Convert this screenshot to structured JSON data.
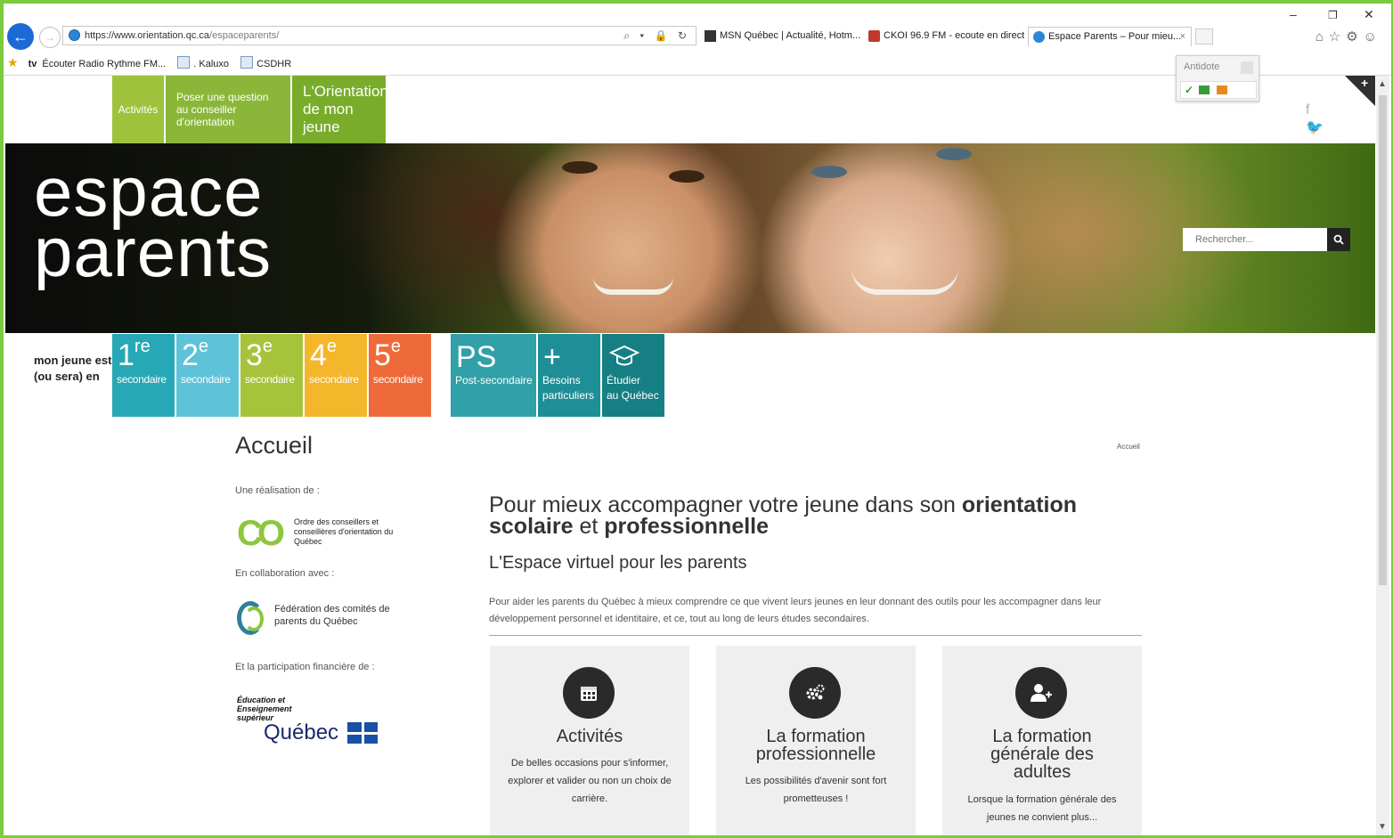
{
  "browser": {
    "url_host": "https://www.orientation.qc.ca",
    "url_path": "/espaceparents/",
    "addr_tools": "⌕ ▾ 🔒 ↻",
    "tabs": [
      {
        "label": "MSN Québec | Actualité, Hotm..."
      },
      {
        "label": "CKOI 96.9 FM - ecoute en direct"
      },
      {
        "label": "Espace Parents – Pour mieu..."
      }
    ],
    "tab_close": "×",
    "favorites": [
      {
        "label": "Écouter Radio Rythme FM..."
      },
      {
        "label": ". Kaluxo"
      },
      {
        "label": "CSDHR"
      }
    ],
    "fav_tv": "tv",
    "win_min": "–",
    "win_restore": "❐",
    "win_close": "✕",
    "right_icons": "⌂☆⚙☺",
    "antidote_label": "Antidote"
  },
  "page": {
    "nav": [
      {
        "label": "Activités"
      },
      {
        "label": "Poser une question au conseiller d'orientation"
      },
      {
        "label": "L'Orientation de mon jeune"
      }
    ],
    "social": "f 🐦",
    "hero_title_1": "espace",
    "hero_title_2": "parents",
    "search_placeholder": "Rechercher...",
    "mon_jeune_1": "mon jeune est",
    "mon_jeune_2": "(ou sera) en",
    "levels": [
      {
        "num": "1",
        "sup": "re",
        "word": "secondaire"
      },
      {
        "num": "2",
        "sup": "e",
        "word": "secondaire"
      },
      {
        "num": "3",
        "sup": "e",
        "word": "secondaire"
      },
      {
        "num": "4",
        "sup": "e",
        "word": "secondaire"
      },
      {
        "num": "5",
        "sup": "e",
        "word": "secondaire"
      }
    ],
    "ps": {
      "big": "PS",
      "small": "Post-secondaire"
    },
    "besoins": {
      "big": "+",
      "small1": "Besoins",
      "small2": "particuliers"
    },
    "etudier": {
      "small1": "Étudier",
      "small2": "au Québec"
    },
    "title": "Accueil",
    "breadcrumb": "Accueil",
    "realisation": "Une réalisation de :",
    "occoq": "Ordre des conseillers et conseillères d'orientation du Québec",
    "collaboration": "En collaboration avec :",
    "fcpq": "Fédération des comités de parents du Québec",
    "financiere": "Et la participation financière de :",
    "eesq": "Éducation et Enseignement supérieur",
    "quebec": "Québec",
    "main_title_1": "Pour mieux accompagner votre jeune dans son ",
    "main_title_b1": "orientation",
    "main_title_b2": "scolaire",
    "main_title_2": " et ",
    "main_title_b3": "professionnelle",
    "subtitle": "L'Espace virtuel pour les parents",
    "intro": "Pour aider les parents du Québec à mieux comprendre ce que vivent leurs jeunes en leur donnant des outils pour les accompagner dans leur développement personnel et identitaire, et ce, tout au long de leurs études secondaires.",
    "cards": [
      {
        "title": "Activités",
        "desc": "De belles occasions pour s'informer, explorer et valider ou non un choix de carrière."
      },
      {
        "title": "La formation professionnelle",
        "desc": "Les possibilités d'avenir sont fort prometteuses !"
      },
      {
        "title": "La formation générale des adultes",
        "desc": "Lorsque la formation générale des jeunes ne convient plus..."
      }
    ]
  },
  "colors": {
    "accent_green": "#8dc63f",
    "frame": "#7ccb3e"
  }
}
